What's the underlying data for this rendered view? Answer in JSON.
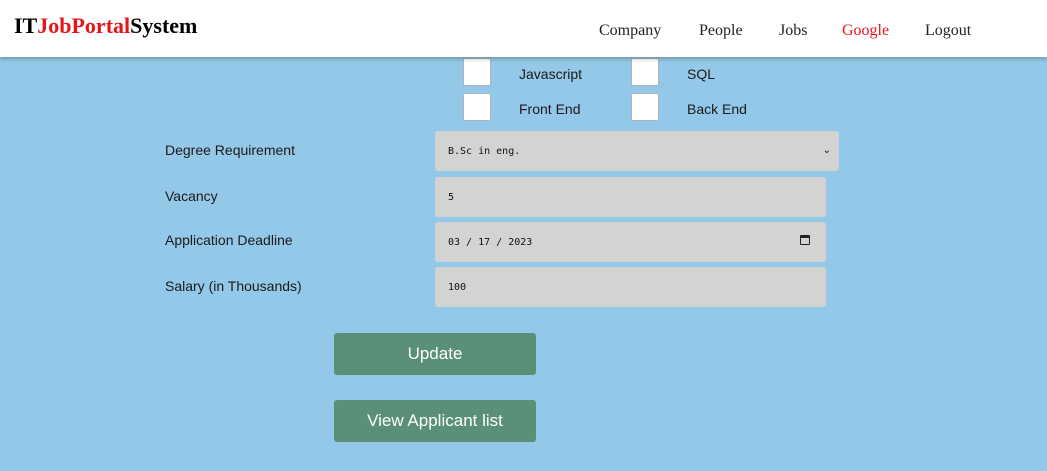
{
  "brand": {
    "part1": "IT",
    "part2": "JobPortal",
    "part3": "System"
  },
  "nav": {
    "company": "Company",
    "people": "People",
    "jobs": "Jobs",
    "google": "Google",
    "logout": "Logout"
  },
  "skills": {
    "javascript": "Javascript",
    "sql": "SQL",
    "frontend": "Front End",
    "backend": "Back End"
  },
  "form": {
    "degree_label": "Degree Requirement",
    "degree_value": "B.Sc in eng.",
    "vacancy_label": "Vacancy",
    "vacancy_value": "5",
    "deadline_label": "Application Deadline",
    "deadline_value": "03 / 17 / 2023",
    "salary_label": "Salary (in Thousands)",
    "salary_value": "100"
  },
  "buttons": {
    "update": "Update",
    "view_applicants": "View Applicant list"
  },
  "colors": {
    "page_bg": "#94c8e8",
    "brand_red": "#e8141b",
    "button_green": "#5a8f78",
    "field_bg": "#d3d3d3"
  }
}
